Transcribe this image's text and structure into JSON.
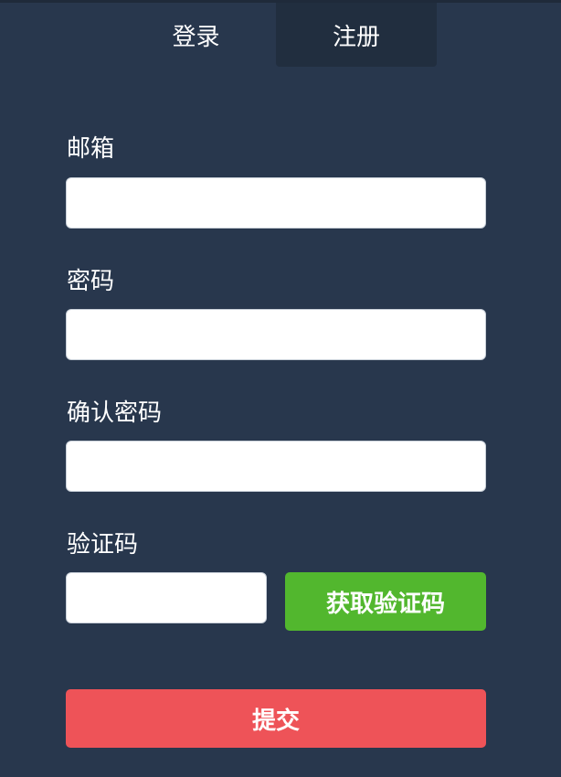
{
  "tabs": {
    "login": "登录",
    "register": "注册",
    "active": "register"
  },
  "form": {
    "email_label": "邮箱",
    "email_value": "",
    "password_label": "密码",
    "password_value": "",
    "confirm_label": "确认密码",
    "confirm_value": "",
    "code_label": "验证码",
    "code_value": "",
    "get_code_button": "获取验证码",
    "submit_button": "提交"
  },
  "colors": {
    "background": "#28374d",
    "active_tab": "#212e3f",
    "get_code_button": "#52b72e",
    "submit_button": "#ee5358"
  }
}
